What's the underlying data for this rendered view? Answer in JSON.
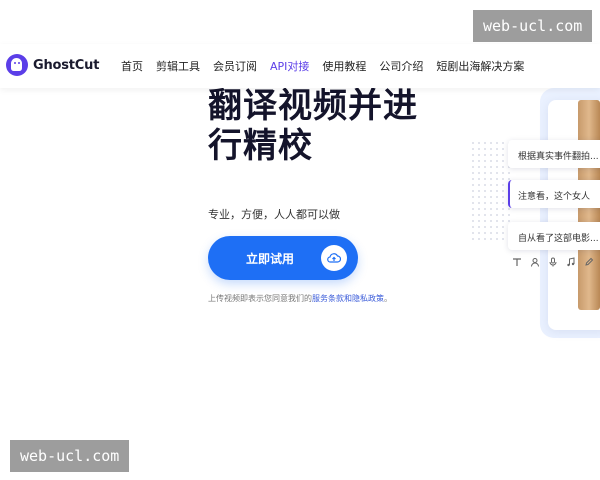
{
  "watermark": {
    "text": "web-ucl.com"
  },
  "brand": {
    "name": "GhostCut",
    "color": "#5b3ee8"
  },
  "nav": {
    "items": [
      {
        "label": "首页",
        "name": "home"
      },
      {
        "label": "剪辑工具",
        "name": "edit-tools"
      },
      {
        "label": "会员订阅",
        "name": "membership"
      },
      {
        "label": "API对接",
        "name": "api"
      },
      {
        "label": "使用教程",
        "name": "tutorials"
      },
      {
        "label": "公司介绍",
        "name": "about"
      },
      {
        "label": "短剧出海解决方案",
        "name": "short-drama-solutions"
      }
    ]
  },
  "hero": {
    "title_line1": "翻译视频并进",
    "title_line2": "行精校",
    "subtitle": "专业，方便，人人都可以做",
    "cta_label": "立即试用",
    "cta_icon": "upload-cloud-icon",
    "terms_prefix": "上传视频即表示您同意我们的",
    "terms_service": "服务条款",
    "terms_and": "和",
    "terms_privacy": "隐私政策",
    "terms_suffix": "。"
  },
  "preview": {
    "subtitles": [
      "根据真实事件翻拍...",
      "注意看，这个女人",
      "自从看了这部电影..."
    ],
    "tools": [
      "text-icon",
      "person-icon",
      "mic-icon",
      "music-icon",
      "edit-icon"
    ]
  },
  "colors": {
    "accent": "#1e6ff5",
    "link": "#3a5bd9"
  }
}
